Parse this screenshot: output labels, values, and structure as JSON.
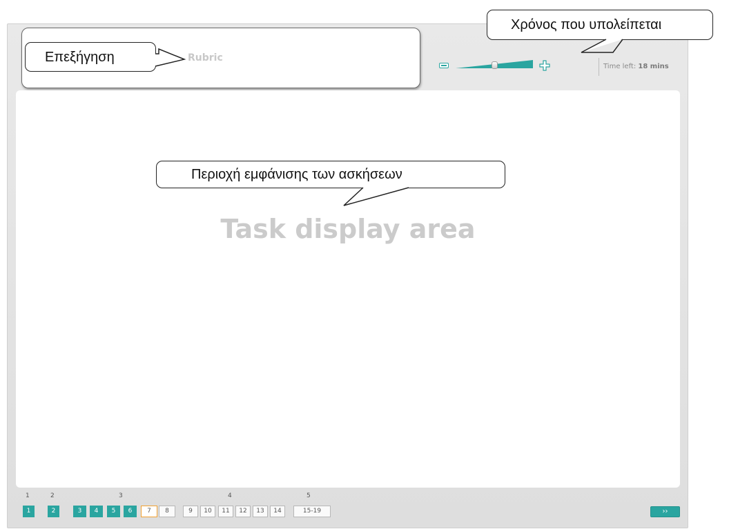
{
  "header": {
    "rubric_label": "Rubric",
    "timer": {
      "label": "Time left:",
      "value": "18 mins"
    },
    "zoom": {
      "level": 0.5
    }
  },
  "task_area": {
    "label": "Task display area"
  },
  "callouts": {
    "explanation": "Επεξήγηση",
    "time_remaining": "Χρόνος που υπολείπεται",
    "task_area": "Περιοχή εμφάνισης των ασκήσεων"
  },
  "navigation": {
    "groups": [
      {
        "label": "1"
      },
      {
        "label": "2"
      },
      {
        "label": "3"
      },
      {
        "label": "4"
      },
      {
        "label": "5"
      }
    ],
    "buttons": [
      {
        "label": "1",
        "state": "done"
      },
      {
        "label": "2",
        "state": "done"
      },
      {
        "label": "3",
        "state": "done"
      },
      {
        "label": "4",
        "state": "done"
      },
      {
        "label": "5",
        "state": "done"
      },
      {
        "label": "6",
        "state": "done"
      },
      {
        "label": "7",
        "state": "current"
      },
      {
        "label": "8",
        "state": "pending"
      },
      {
        "label": "9",
        "state": "pending"
      },
      {
        "label": "10",
        "state": "pending"
      },
      {
        "label": "11",
        "state": "pending"
      },
      {
        "label": "12",
        "state": "pending"
      },
      {
        "label": "13",
        "state": "pending"
      },
      {
        "label": "14",
        "state": "pending"
      },
      {
        "label": "15-19",
        "state": "pending"
      }
    ],
    "next_label": "››"
  },
  "colors": {
    "accent": "#2aa5a0",
    "current_border": "#f0a030"
  }
}
